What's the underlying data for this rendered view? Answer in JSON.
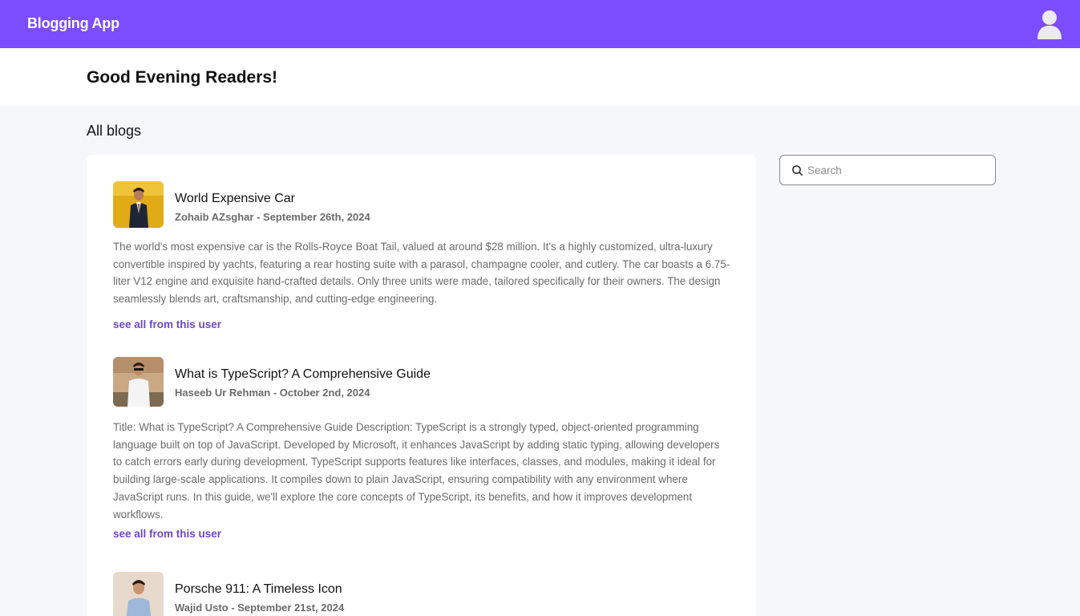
{
  "navbar": {
    "brand": "Blogging App",
    "accent_color": "#7c4dff",
    "profile_icon": "user-avatar-icon"
  },
  "header": {
    "greeting": "Good Evening Readers!"
  },
  "main": {
    "section_title": "All blogs",
    "posts": [
      {
        "title": "World Expensive Car",
        "author": "Zohaib AZsghar",
        "date": "September 26th, 2024",
        "byline": "Zohaib AZsghar - September 26th, 2024",
        "body": "The world's most expensive car is the Rolls-Royce Boat Tail, valued at around $28 million. It's a highly customized, ultra-luxury convertible inspired by yachts, featuring a rear hosting suite with a parasol, champagne cooler, and cutlery. The car boasts a 6.75-liter V12 engine and exquisite hand-crafted details. Only three units were made, tailored specifically for their owners. The design seamlessly blends art, craftsmanship, and cutting-edge engineering.",
        "link": "see all from this user"
      },
      {
        "title": "What is TypeScript? A Comprehensive Guide",
        "author": "Haseeb Ur Rehman",
        "date": "October 2nd, 2024",
        "byline": "Haseeb Ur Rehman - October 2nd, 2024",
        "body": "Title: What is TypeScript? A Comprehensive Guide Description: TypeScript is a strongly typed, object-oriented programming language built on top of JavaScript. Developed by Microsoft, it enhances JavaScript by adding static typing, allowing developers to catch errors early during development. TypeScript supports features like interfaces, classes, and modules, making it ideal for building large-scale applications. It compiles down to plain JavaScript, ensuring compatibility with any environment where JavaScript runs. In this guide, we'll explore the core concepts of TypeScript, its benefits, and how it improves development workflows.",
        "link": "see all from this user"
      },
      {
        "title": "Porsche 911: A Timeless Icon",
        "author": "Wajid Usto",
        "date": "September 21st, 2024",
        "byline": "Wajid Usto - September 21st, 2024"
      }
    ]
  },
  "sidebar": {
    "search_placeholder": "Search",
    "search_value": ""
  }
}
